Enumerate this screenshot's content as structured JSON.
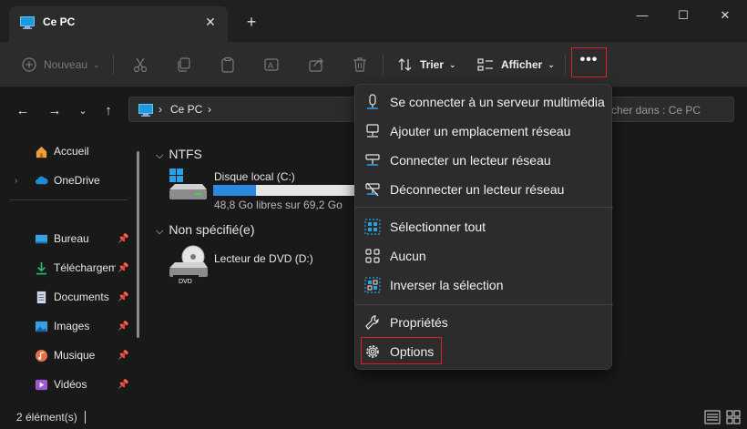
{
  "window": {
    "tab_title": "Ce PC",
    "tab_close": "✕",
    "new_tab": "+",
    "minimize": "—",
    "maximize": "☐",
    "close": "✕"
  },
  "toolbar": {
    "new_label": "Nouveau",
    "sort_label": "Trier",
    "view_label": "Afficher",
    "more_label": "•••"
  },
  "address": {
    "crumb_sep": "›",
    "crumb_pc": "Ce PC",
    "crumb_end": "›",
    "search_placeholder": "rcher dans : Ce PC"
  },
  "sidebar": {
    "items": [
      {
        "label": "Accueil",
        "icon": "home-icon"
      },
      {
        "label": "OneDrive",
        "icon": "cloud-icon"
      },
      {
        "label": "Bureau",
        "icon": "desktop-icon",
        "pinned": true
      },
      {
        "label": "Téléchargem",
        "icon": "download-icon",
        "pinned": true
      },
      {
        "label": "Documents",
        "icon": "document-icon",
        "pinned": true
      },
      {
        "label": "Images",
        "icon": "image-icon",
        "pinned": true
      },
      {
        "label": "Musique",
        "icon": "music-icon",
        "pinned": true
      },
      {
        "label": "Vidéos",
        "icon": "video-icon",
        "pinned": true
      }
    ]
  },
  "main": {
    "groups": [
      {
        "header": "NTFS",
        "drives": [
          {
            "name": "Disque local (C:)",
            "detail": "48,8 Go libres sur 69,2 Go",
            "used_fraction": 0.295
          }
        ]
      },
      {
        "header": "Non spécifié(e)",
        "drives": [
          {
            "name": "Lecteur de DVD (D:)",
            "badge": "DVD"
          }
        ]
      }
    ]
  },
  "menu": {
    "items": [
      {
        "label": "Se connecter à un serveur multimédia",
        "icon": "media-server-icon"
      },
      {
        "label": "Ajouter un emplacement réseau",
        "icon": "network-location-icon"
      },
      {
        "label": "Connecter un lecteur réseau",
        "icon": "map-drive-icon"
      },
      {
        "label": "Déconnecter un lecteur réseau",
        "icon": "disconnect-drive-icon"
      },
      {
        "label": "Sélectionner tout",
        "icon": "select-all-icon"
      },
      {
        "label": "Aucun",
        "icon": "select-none-icon"
      },
      {
        "label": "Inverser la sélection",
        "icon": "invert-selection-icon"
      },
      {
        "label": "Propriétés",
        "icon": "wrench-icon"
      },
      {
        "label": "Options",
        "icon": "gear-icon"
      }
    ]
  },
  "status": {
    "count": "2 élément(s)"
  },
  "colors": {
    "accent": "#2b8ae0",
    "highlight_border": "#e02020",
    "background": "#191919",
    "panel": "#2c2c2c"
  }
}
